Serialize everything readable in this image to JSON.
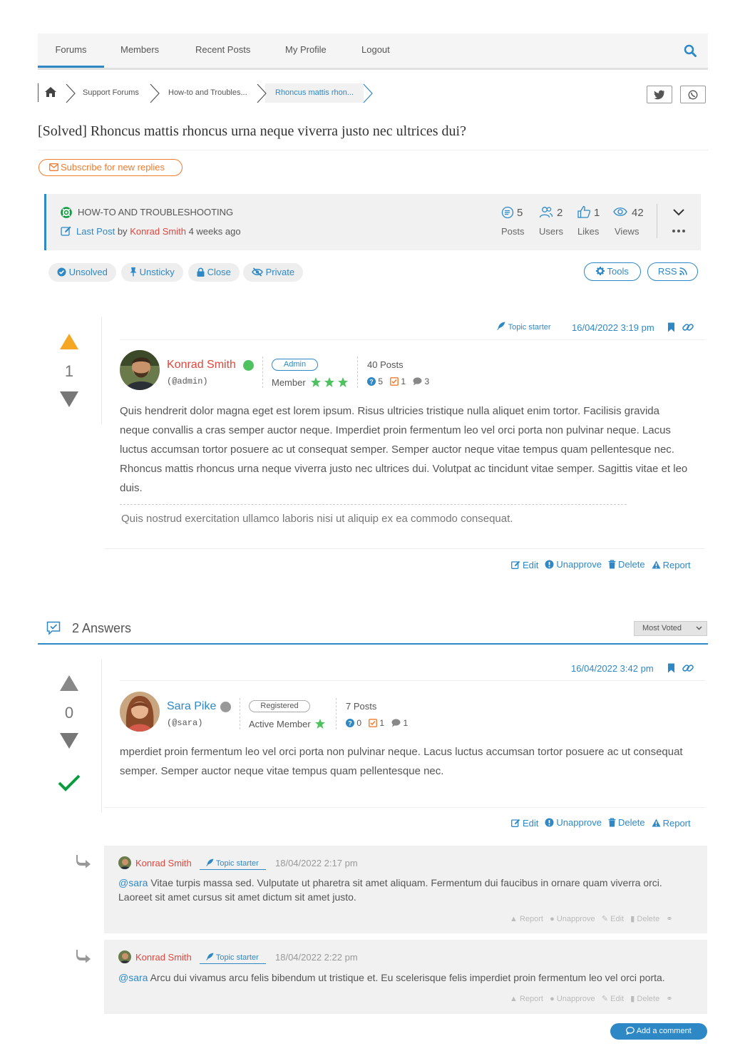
{
  "nav": {
    "items": [
      {
        "label": "Forums"
      },
      {
        "label": "Members"
      },
      {
        "label": "Recent Posts"
      },
      {
        "label": "My Profile"
      },
      {
        "label": "Logout"
      }
    ]
  },
  "breadcrumb": {
    "items": [
      "Support Forums",
      "How-to and Troubles...",
      "Rhoncus mattis rhon..."
    ]
  },
  "topic": {
    "title": "[Solved] Rhoncus mattis rhoncus urna neque viverra justo nec ultrices dui?",
    "subscribe_label": "Subscribe for new replies",
    "forum_name": "HOW-TO AND TROUBLESHOOTING",
    "last_post_label": "Last Post",
    "by": "by",
    "last_post_author": "Konrad Smith",
    "last_post_time": "4 weeks ago",
    "stats": [
      {
        "value": "5",
        "label": "Posts"
      },
      {
        "value": "2",
        "label": "Users"
      },
      {
        "value": "1",
        "label": "Likes"
      },
      {
        "value": "42",
        "label": "Views"
      }
    ],
    "controls": [
      "Unsolved",
      "Unsticky",
      "Close",
      "Private"
    ],
    "tools_label": "Tools",
    "rss_label": "RSS"
  },
  "question": {
    "topic_starter": "Topic starter",
    "date": "16/04/2022 3:19 pm",
    "votes": "1",
    "author": "Konrad Smith",
    "handle": "(@admin)",
    "role": "Admin",
    "rank": "Member",
    "posts": "40 Posts",
    "counts": {
      "questions": "5",
      "answers": "1",
      "comments": "3"
    },
    "body": "Quis hendrerit dolor magna eget est lorem ipsum. Risus ultricies tristique nulla aliquet enim tortor. Facilisis gravida neque convallis a cras semper auctor neque. Imperdiet proin fermentum leo vel orci porta non pulvinar neque. Lacus luctus accumsan tortor posuere ac ut consequat semper. Semper auctor neque vitae tempus quam pellentesque nec. Rhoncus mattis rhoncus urna neque viverra justo nec ultrices dui. Volutpat ac tincidunt vitae semper. Sagittis vitae et leo duis.",
    "signature": "Quis nostrud exercitation ullamco laboris nisi ut aliquip ex ea commodo consequat."
  },
  "post_actions": {
    "edit": "Edit",
    "unapprove": "Unapprove",
    "delete": "Delete",
    "report": "Report"
  },
  "answers": {
    "count_label": "2 Answers",
    "sort": "Most Voted"
  },
  "answer": {
    "date": "16/04/2022 3:42 pm",
    "votes": "0",
    "author": "Sara Pike",
    "handle": "(@sara)",
    "role": "Registered",
    "rank": "Active Member",
    "posts": "7 Posts",
    "counts": {
      "questions": "0",
      "answers": "1",
      "comments": "1"
    },
    "body": "mperdiet proin fermentum leo vel orci porta non pulvinar neque. Lacus luctus accumsan tortor posuere ac ut consequat semper. Semper auctor neque vitae tempus quam pellentesque nec."
  },
  "comments": [
    {
      "author": "Konrad Smith",
      "badge": "Topic starter",
      "date": "18/04/2022 2:17 pm",
      "mention": "@sara",
      "text": "Vitae turpis massa sed. Vulputate ut pharetra sit amet aliquam. Fermentum dui faucibus in ornare quam viverra orci. Laoreet sit amet cursus sit amet dictum sit amet justo."
    },
    {
      "author": "Konrad Smith",
      "badge": "Topic starter",
      "date": "18/04/2022 2:22 pm",
      "mention": "@sara",
      "text": "Arcu dui vivamus arcu felis bibendum ut tristique et. Eu scelerisque felis imperdiet proin fermentum leo vel orci porta."
    }
  ],
  "comment_actions": {
    "report": "Report",
    "unapprove": "Unapprove",
    "edit": "Edit",
    "delete": "Delete"
  },
  "add_comment_label": "Add a comment",
  "colors": {
    "accent": "#2e88c6",
    "author": "#e2453c",
    "orange": "#f07c2e",
    "green": "#0a9c3e",
    "vote": "#f5a623"
  }
}
